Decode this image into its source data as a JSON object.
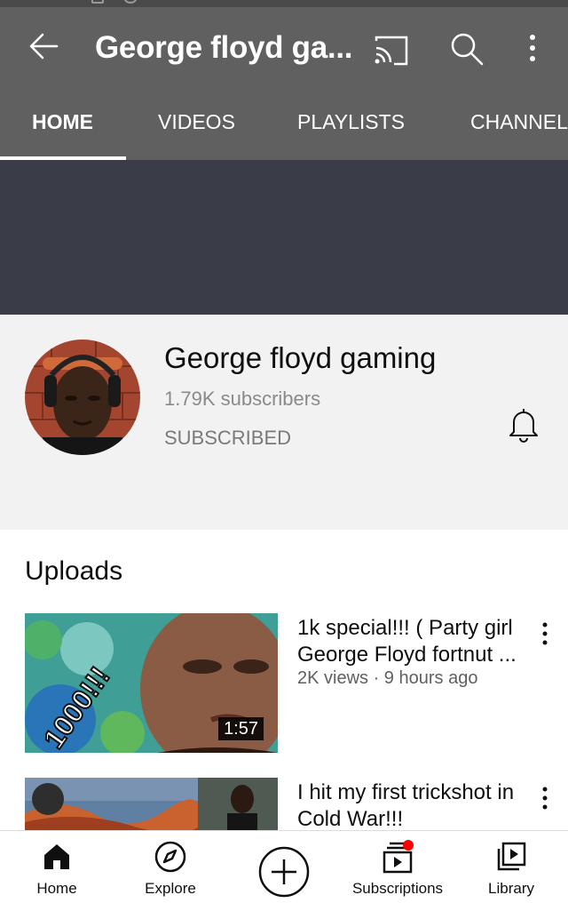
{
  "appbar": {
    "title": "George floyd ga...",
    "back_icon": "back-arrow-icon",
    "cast_icon": "cast-icon",
    "search_icon": "search-icon",
    "more_icon": "more-vert-icon"
  },
  "tabs": [
    {
      "label": "HOME",
      "active": true
    },
    {
      "label": "VIDEOS",
      "active": false
    },
    {
      "label": "PLAYLISTS",
      "active": false
    },
    {
      "label": "CHANNELS",
      "active": false
    }
  ],
  "channel": {
    "name": "George floyd gaming",
    "subscribers": "1.79K subscribers",
    "subscribe_status": "SUBSCRIBED",
    "bell_icon": "bell-icon"
  },
  "uploads": {
    "heading": "Uploads",
    "videos": [
      {
        "title": "1k special!!! ( Party girl George Floyd fortnut ...",
        "meta": "2K views · 9 hours ago",
        "duration": "1:57",
        "thumb_text": "1000!!!"
      },
      {
        "title": "I hit my first trickshot in Cold War!!!",
        "meta": "",
        "duration": ""
      }
    ]
  },
  "bottom_nav": [
    {
      "label": "Home",
      "icon": "home-icon"
    },
    {
      "label": "Explore",
      "icon": "explore-icon"
    },
    {
      "label": "",
      "icon": "create-icon"
    },
    {
      "label": "Subscriptions",
      "icon": "subscriptions-icon"
    },
    {
      "label": "Library",
      "icon": "library-icon"
    }
  ],
  "colors": {
    "appbar": "#606060",
    "banner": "#3a3d48",
    "channel_header": "#f2f2f2",
    "notification_dot": "#ff0000"
  }
}
